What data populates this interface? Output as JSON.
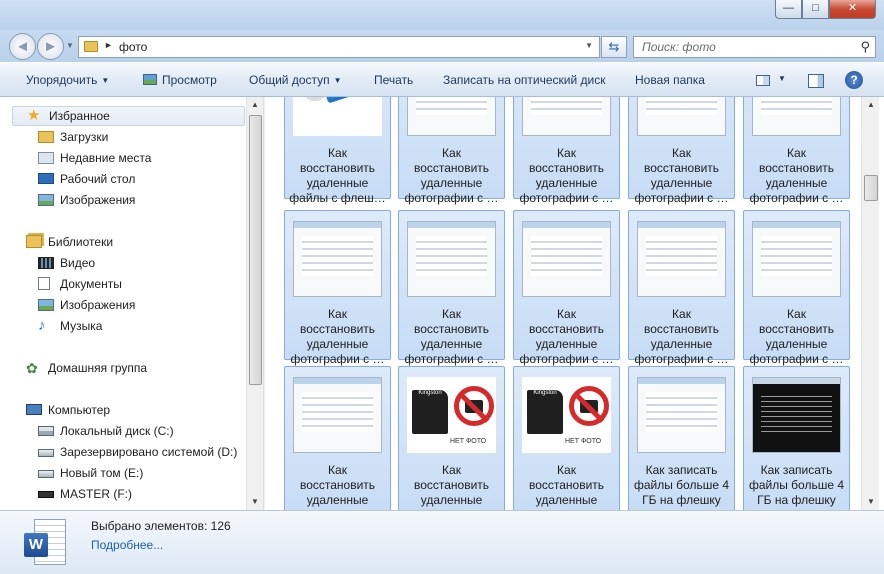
{
  "window": {
    "minimize": "—",
    "maximize": "□",
    "close": "✕"
  },
  "nav": {
    "back_icon": "◄",
    "forward_icon": "►",
    "path": "фото",
    "search_placeholder": "Поиск: фото"
  },
  "toolbar": {
    "organize": "Упорядочить",
    "preview": "Просмотр",
    "share": "Общий доступ",
    "print": "Печать",
    "burn": "Записать на оптический диск",
    "new_folder": "Новая папка"
  },
  "sidebar": {
    "favorites": "Избранное",
    "downloads": "Загрузки",
    "recent": "Недавние места",
    "desktop": "Рабочий стол",
    "fav_images": "Изображения",
    "libraries": "Библиотеки",
    "video": "Видео",
    "documents": "Документы",
    "lib_images": "Изображения",
    "music": "Музыка",
    "homegroup": "Домашняя группа",
    "computer": "Компьютер",
    "drive_c": "Локальный диск (C:)",
    "drive_d": "Зарезервировано системой (D:)",
    "drive_e": "Новый том (E:)",
    "drive_f": "MASTER (F:)"
  },
  "files": {
    "t1": "Как восстановить удаленные файлы с флеш…",
    "t2": "Как восстановить удаленные фотографии с …",
    "t3": "Как восстановить удаленные фотографии с …",
    "t4": "Как восстановить удаленные фотографии с …",
    "t5": "Как восстановить удаленные фотографии с …",
    "t6": "Как восстановить удаленные фотографии с …",
    "t7": "Как восстановить удаленные фотографии с …",
    "t8": "Как восстановить удаленные фотографии с …",
    "t9": "Как восстановить удаленные фотографии с …",
    "t10": "Как восстановить удаленные фотографии с …",
    "t11": "Как восстановить удаленные",
    "t12": "Как восстановить удаленные",
    "t13": "Как восстановить удаленные",
    "t14": "Как записать файлы больше 4 ГБ на флешку",
    "t15": "Как записать файлы больше 4 ГБ на флешку",
    "nofoto_label": "НЕТ ФОТО",
    "sd_label": "Kingston"
  },
  "details": {
    "selected": "Выбрано элементов: 126",
    "more": "Подробнее..."
  }
}
